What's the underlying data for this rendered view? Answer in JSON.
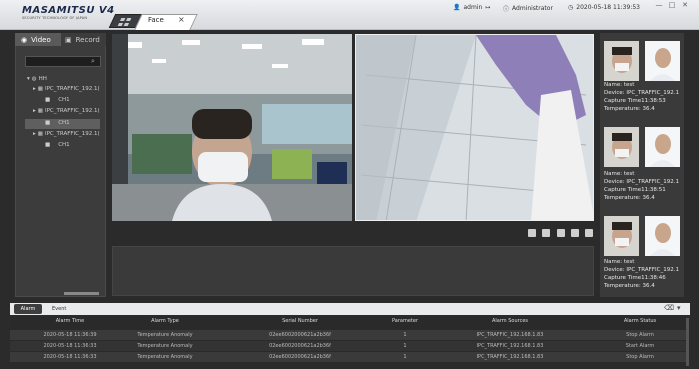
{
  "app": {
    "logo_main": "MASAMITSU V4",
    "logo_sub": "SECURITY TECHNOLOGY OF JAPAN"
  },
  "titlebar": {
    "tab_label": "Face",
    "tab_close": "×",
    "user": "admin",
    "role": "Administrator",
    "datetime": "2020-05-18 11:39:53",
    "min": "—",
    "max": "□",
    "close": "✕"
  },
  "left": {
    "tab_video": "Video",
    "tab_record": "Record",
    "tree": [
      {
        "label": "HH",
        "kind": "group"
      },
      {
        "label": "IPC_TRAFFIC_192.1(",
        "kind": "device"
      },
      {
        "label": "CH1",
        "kind": "channel"
      },
      {
        "label": "IPC_TRAFFIC_192.1(",
        "kind": "device"
      },
      {
        "label": "CH1",
        "kind": "channel"
      },
      {
        "label": "IPC_TRAFFIC_192.1(",
        "kind": "device"
      },
      {
        "label": "CH1",
        "kind": "channel"
      }
    ]
  },
  "captures": [
    {
      "name": "Name:  test",
      "device": "Device:  IPC_TRAFFIC_192.1",
      "time": "Capture Time11:38:53",
      "temp": "Temperature:  36.4"
    },
    {
      "name": "Name:  test",
      "device": "Device:  IPC_TRAFFIC_192.1",
      "time": "Capture Time11:38:51",
      "temp": "Temperature:  36.4"
    },
    {
      "name": "Name:  test",
      "device": "Device:  IPC_TRAFFIC_192.1",
      "time": "Capture Time11:38:46",
      "temp": "Temperature:  36.4"
    }
  ],
  "alarm": {
    "tab_alarm": "Alarm",
    "tab_event": "Event",
    "columns": [
      "Alarm Time",
      "Alarm Type",
      "Serial Number",
      "Parameter",
      "Alarm Sources",
      "Alarm Status"
    ],
    "rows": [
      [
        "2020-05-18 11:36:39",
        "Temperature Anomaly",
        "02ee6002000621a2b36f",
        "1",
        "IPC_TRAFFIC_192.168.1.83",
        "Stop Alarm"
      ],
      [
        "2020-05-18 11:36:33",
        "Temperature Anomaly",
        "02ee6002000621a2b36f",
        "1",
        "IPC_TRAFFIC_192.168.1.83",
        "Start Alarm"
      ],
      [
        "2020-05-18 11:36:33",
        "Temperature Anomaly",
        "02ee6002000621a2b36f",
        "1",
        "IPC_TRAFFIC_192.168.1.83",
        "Stop Alarm"
      ]
    ]
  },
  "colors": {
    "accent": "#3e3e3e",
    "panel": "#3c3c3c",
    "background": "#2b2b2b"
  }
}
